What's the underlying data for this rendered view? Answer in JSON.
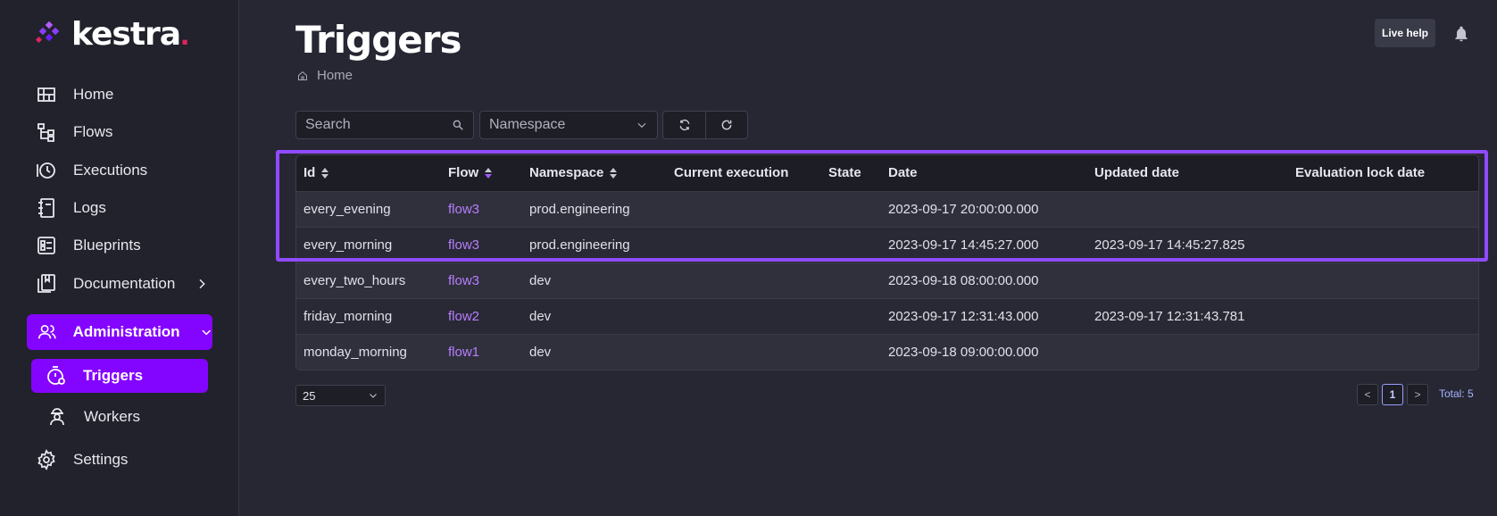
{
  "brand": {
    "name": "kestra",
    "accent": "#8405ff",
    "dot_color": "#e0245e"
  },
  "sidebar": {
    "items": [
      {
        "label": "Home",
        "icon": "home-grid-icon"
      },
      {
        "label": "Flows",
        "icon": "flows-icon"
      },
      {
        "label": "Executions",
        "icon": "executions-history-icon"
      },
      {
        "label": "Logs",
        "icon": "logs-notebook-icon"
      },
      {
        "label": "Blueprints",
        "icon": "blueprints-icon"
      },
      {
        "label": "Documentation",
        "icon": "documentation-book-icon"
      },
      {
        "label": "Administration",
        "icon": "administration-users-icon"
      },
      {
        "label": "Triggers",
        "icon": "triggers-timer-icon"
      },
      {
        "label": "Workers",
        "icon": "workers-icon"
      },
      {
        "label": "Settings",
        "icon": "settings-gear-icon"
      }
    ]
  },
  "header": {
    "title": "Triggers",
    "breadcrumb": "Home",
    "live_help": "Live help"
  },
  "filters": {
    "search_placeholder": "Search",
    "namespace_placeholder": "Namespace"
  },
  "table": {
    "columns": [
      "Id",
      "Flow",
      "Namespace",
      "Current execution",
      "State",
      "Date",
      "Updated date",
      "Evaluation lock date"
    ],
    "rows": [
      {
        "id": "every_evening",
        "flow": "flow3",
        "namespace": "prod.engineering",
        "current_execution": "",
        "state": "",
        "date": "2023-09-17 20:00:00.000",
        "updated_date": "",
        "evaluation_lock_date": ""
      },
      {
        "id": "every_morning",
        "flow": "flow3",
        "namespace": "prod.engineering",
        "current_execution": "",
        "state": "",
        "date": "2023-09-17 14:45:27.000",
        "updated_date": "2023-09-17 14:45:27.825",
        "evaluation_lock_date": ""
      },
      {
        "id": "every_two_hours",
        "flow": "flow3",
        "namespace": "dev",
        "current_execution": "",
        "state": "",
        "date": "2023-09-18 08:00:00.000",
        "updated_date": "",
        "evaluation_lock_date": ""
      },
      {
        "id": "friday_morning",
        "flow": "flow2",
        "namespace": "dev",
        "current_execution": "",
        "state": "",
        "date": "2023-09-17 12:31:43.000",
        "updated_date": "2023-09-17 12:31:43.781",
        "evaluation_lock_date": ""
      },
      {
        "id": "monday_morning",
        "flow": "flow1",
        "namespace": "dev",
        "current_execution": "",
        "state": "",
        "date": "2023-09-18 09:00:00.000",
        "updated_date": "",
        "evaluation_lock_date": ""
      }
    ]
  },
  "pagination": {
    "page_size": "25",
    "prev": "<",
    "current_page": "1",
    "next": ">",
    "total": "Total: 5"
  }
}
